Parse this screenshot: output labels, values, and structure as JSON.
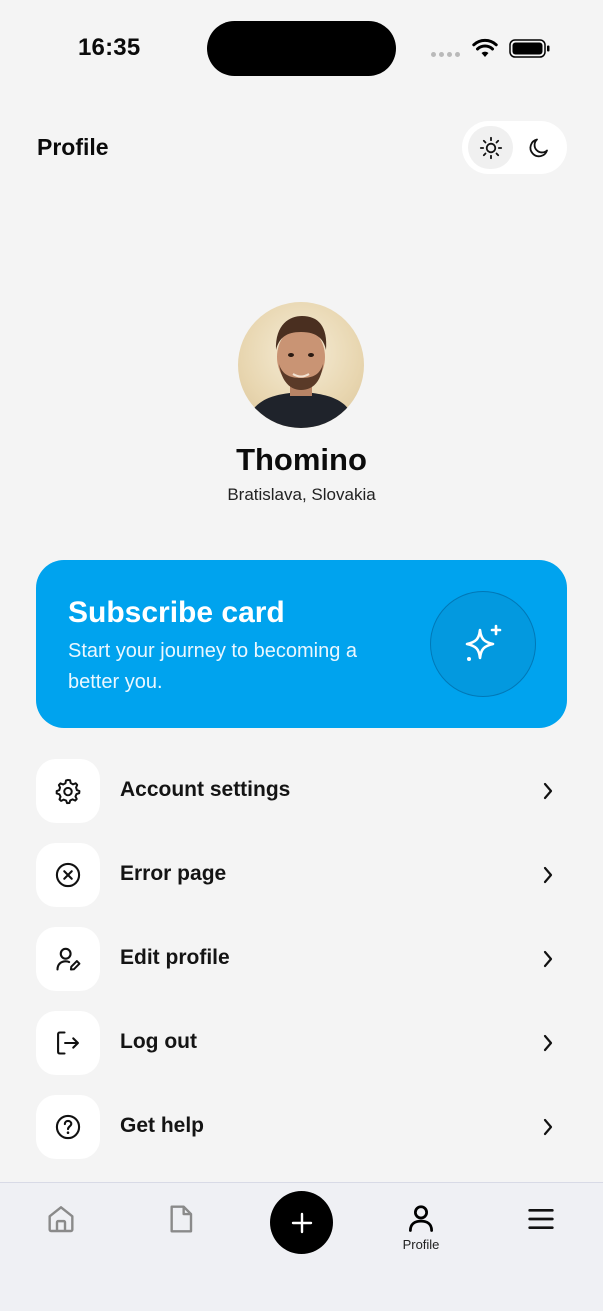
{
  "status_bar": {
    "time": "16:35",
    "icons": [
      "cellular-signal-icon",
      "wifi-icon",
      "battery-icon"
    ]
  },
  "header": {
    "title": "Profile",
    "theme_toggle": {
      "options": [
        "sun-icon",
        "moon-icon"
      ],
      "selected": "light"
    }
  },
  "profile": {
    "name": "Thomino",
    "location": "Bratislava, Slovakia"
  },
  "subscribe_card": {
    "title": "Subscribe card",
    "text": "Start your journey to becoming a better you.",
    "icon": "sparkles-icon",
    "color": "#00a3ee"
  },
  "menu": {
    "items": [
      {
        "label": "Account settings",
        "icon": "gear-icon"
      },
      {
        "label": "Error page",
        "icon": "circle-x-icon"
      },
      {
        "label": "Edit profile",
        "icon": "user-edit-icon"
      },
      {
        "label": "Log out",
        "icon": "logout-icon"
      },
      {
        "label": "Get help",
        "icon": "help-circle-icon"
      }
    ]
  },
  "bottom_nav": {
    "items": [
      {
        "icon": "home-icon",
        "label": ""
      },
      {
        "icon": "document-icon",
        "label": ""
      },
      {
        "icon": "plus-icon",
        "label": ""
      },
      {
        "icon": "user-icon",
        "label": "Profile",
        "active": true
      },
      {
        "icon": "menu-icon",
        "label": ""
      }
    ]
  }
}
